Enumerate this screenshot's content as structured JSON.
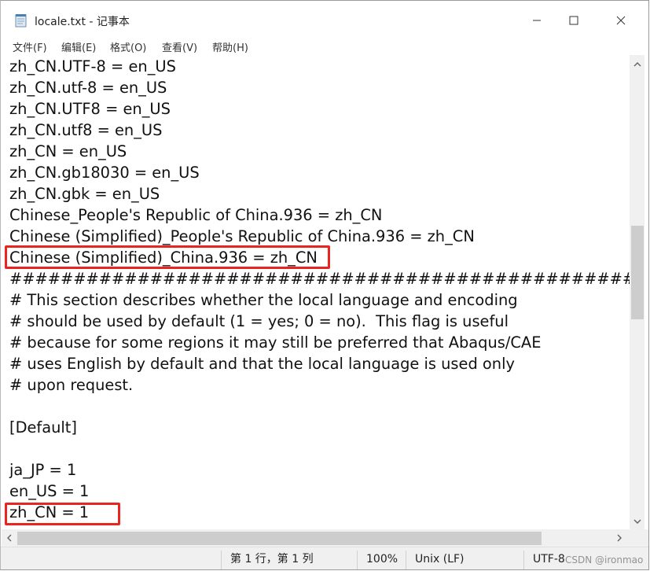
{
  "window": {
    "title": "locale.txt - 记事本",
    "controls": {
      "minimize": "—",
      "maximize": "☐",
      "close": "✕"
    }
  },
  "menu": [
    "文件(F)",
    "编辑(E)",
    "格式(O)",
    "查看(V)",
    "帮助(H)"
  ],
  "document": {
    "lines": [
      "zh_CN.UTF-8 = en_US",
      "zh_CN.utf-8 = en_US",
      "zh_CN.UTF8 = en_US",
      "zh_CN.utf8 = en_US",
      "zh_CN = en_US",
      "zh_CN.gb18030 = en_US",
      "zh_CN.gbk = en_US",
      "Chinese_People's Republic of China.936 = zh_CN",
      "Chinese (Simplified)_People's Republic of China.936 = zh_CN",
      "Chinese (Simplified)_China.936 = zh_CN",
      "##################################################",
      "# This section describes whether the local language and encoding",
      "# should be used by default (1 = yes; 0 = no).  This flag is useful",
      "# because for some regions it may still be preferred that Abaqus/CAE",
      "# uses English by default and that the local language is used only",
      "# upon request.",
      "",
      "[Default]",
      "",
      "ja_JP = 1",
      "en_US = 1",
      "zh_CN = 1"
    ]
  },
  "status": {
    "position": "第 1 行，第 1 列",
    "zoom": "100%",
    "line_ending": "Unix (LF)",
    "encoding": "UTF-8"
  },
  "watermark": "CSDN @ironmao",
  "colors": {
    "highlight": "#e8261f",
    "status_bg": "#f0f0f0"
  }
}
